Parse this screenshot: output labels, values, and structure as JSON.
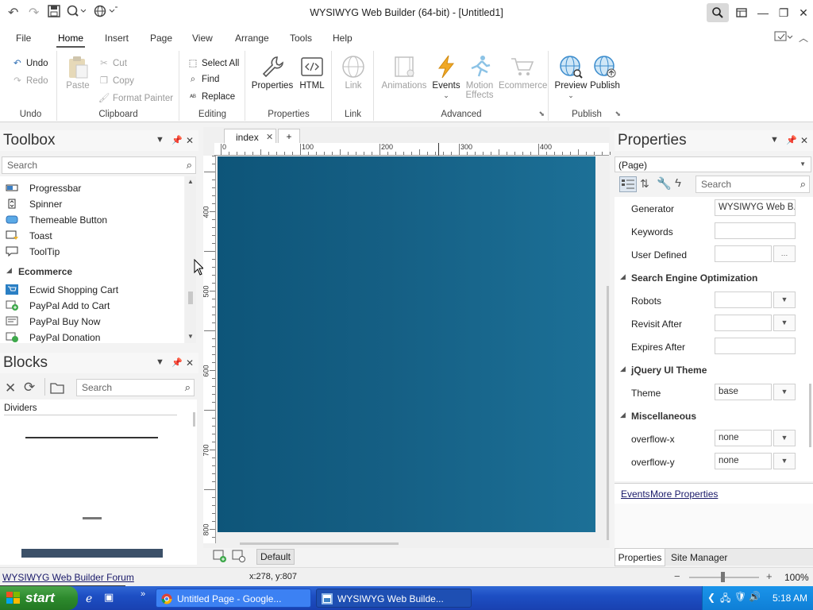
{
  "window": {
    "title": "WYSIWYG Web Builder (64-bit) - [Untitled1]"
  },
  "menu": {
    "tabs": [
      "File",
      "Home",
      "Insert",
      "Page",
      "View",
      "Arrange",
      "Tools",
      "Help"
    ],
    "active": "Home"
  },
  "ribbon": {
    "undo": {
      "undo": "Undo",
      "redo": "Redo",
      "label": "Undo"
    },
    "clipboard": {
      "paste": "Paste",
      "cut": "Cut",
      "copy": "Copy",
      "format_painter": "Format Painter",
      "label": "Clipboard"
    },
    "editing": {
      "select_all": "Select All",
      "find": "Find",
      "replace": "Replace",
      "label": "Editing"
    },
    "properties": {
      "properties": "Properties",
      "html": "HTML",
      "label": "Properties"
    },
    "link": {
      "link": "Link",
      "label": "Link"
    },
    "advanced": {
      "animations": "Animations",
      "events": "Events",
      "motion1": "Motion",
      "motion2": "Effects",
      "ecommerce": "Ecommerce",
      "label": "Advanced"
    },
    "publish": {
      "preview": "Preview",
      "publish": "Publish",
      "label": "Publish"
    }
  },
  "toolbox": {
    "title": "Toolbox",
    "search_placeholder": "Search",
    "items": [
      {
        "label": "Progressbar"
      },
      {
        "label": "Spinner"
      },
      {
        "label": "Themeable Button"
      },
      {
        "label": "Toast"
      },
      {
        "label": "ToolTip"
      }
    ],
    "section": "Ecommerce",
    "ecommerce_items": [
      {
        "label": "Ecwid Shopping Cart"
      },
      {
        "label": "PayPal Add to Cart"
      },
      {
        "label": "PayPal Buy Now"
      },
      {
        "label": "PayPal Donation"
      }
    ]
  },
  "blocks": {
    "title": "Blocks",
    "search_placeholder": "Search",
    "category": "Dividers"
  },
  "document": {
    "tab": "index",
    "add_tab": "+",
    "ruler_h": [
      "0",
      "100",
      "200",
      "300",
      "400"
    ],
    "ruler_v": [
      "400",
      "500",
      "600",
      "700",
      "800"
    ],
    "layer_button": "Default"
  },
  "properties": {
    "title": "Properties",
    "object": "(Page)",
    "search_placeholder": "Search",
    "rows": [
      {
        "type": "prop",
        "name": "Generator",
        "value": "WYSIWYG Web B..."
      },
      {
        "type": "prop",
        "name": "Keywords",
        "value": ""
      },
      {
        "type": "prop_btn",
        "name": "User Defined",
        "value": ""
      },
      {
        "type": "section",
        "name": "Search Engine Optimization"
      },
      {
        "type": "combo",
        "name": "Robots",
        "value": ""
      },
      {
        "type": "combo",
        "name": "Revisit After",
        "value": ""
      },
      {
        "type": "prop",
        "name": "Expires After",
        "value": ""
      },
      {
        "type": "section",
        "name": "jQuery UI Theme"
      },
      {
        "type": "combo",
        "name": "Theme",
        "value": "base"
      },
      {
        "type": "section",
        "name": "Miscellaneous"
      },
      {
        "type": "combo",
        "name": "overflow-x",
        "value": "none"
      },
      {
        "type": "combo",
        "name": "overflow-y",
        "value": "none"
      }
    ],
    "links": {
      "events": "Events",
      "more": "More Properties"
    },
    "bottom_tabs": [
      "Properties",
      "Site Manager"
    ]
  },
  "status": {
    "forum_link": "WYSIWYG Web Builder Forum",
    "coords": "x:278, y:807",
    "zoom": "100%"
  },
  "taskbar": {
    "start": "start",
    "tasks": [
      "Untitled Page - Google...",
      "WYSIWYG Web Builde..."
    ],
    "time": "5:18 AM"
  }
}
